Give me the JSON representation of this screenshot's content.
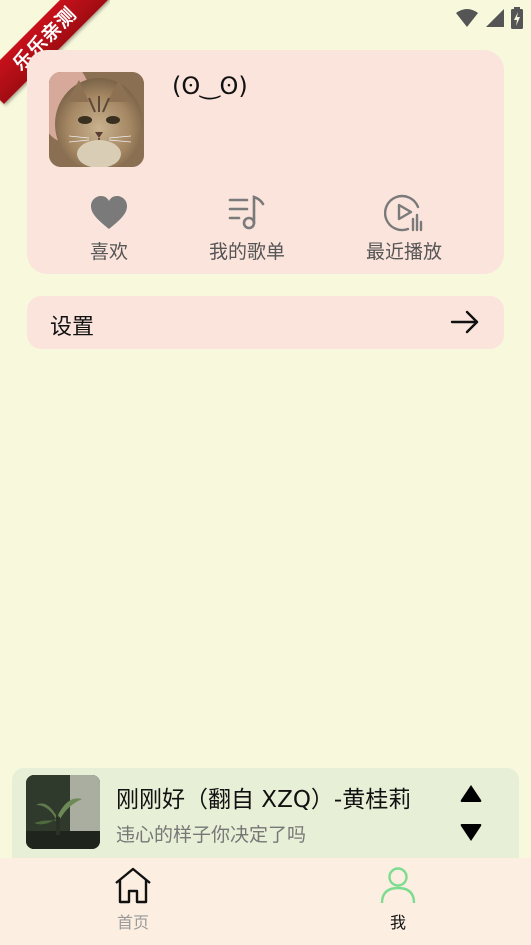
{
  "watermark": {
    "text": "乐乐亲测",
    "color": "#c8111b"
  },
  "status_bar": {
    "icons": [
      "wifi-icon",
      "signal-icon",
      "battery-icon"
    ]
  },
  "profile": {
    "nickname": "(ʘ‿ʘ)",
    "avatar": "cat-photo",
    "shortcuts": [
      {
        "label": "喜欢",
        "icon": "heart-icon"
      },
      {
        "label": "我的歌单",
        "icon": "playlist-icon"
      },
      {
        "label": "最近播放",
        "icon": "recent-play-icon"
      }
    ]
  },
  "settings": {
    "label": "设置",
    "icon": "arrow-right-icon"
  },
  "player": {
    "title": "刚刚好（翻自 XZQ）-黄桂莉",
    "subtitle": "违心的样子你决定了吗",
    "controls": [
      "triangle-up-icon",
      "triangle-down-icon"
    ]
  },
  "nav": {
    "items": [
      {
        "label": "首页",
        "icon": "home-icon",
        "active": false
      },
      {
        "label": "我",
        "icon": "person-icon",
        "active": true
      }
    ],
    "colors": {
      "active_icon": "#7ddc8f",
      "inactive_label": "#9a9a9a"
    }
  },
  "colors": {
    "background": "#f8f9dc",
    "card": "#fbe4dc",
    "player": "#e7efd6",
    "nav": "#fcefe2"
  }
}
